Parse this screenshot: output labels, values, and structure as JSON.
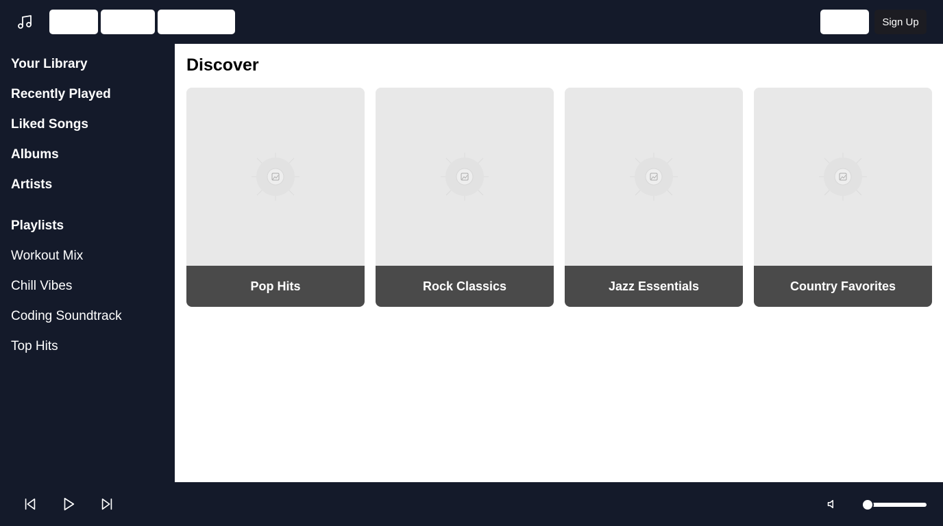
{
  "header": {
    "logo_icon": "music-note-icon",
    "nav_buttons": [
      "",
      "",
      ""
    ],
    "login_label": "",
    "signup_label": "Sign Up"
  },
  "sidebar": {
    "library_items": [
      {
        "label": "Your Library"
      },
      {
        "label": "Recently Played"
      },
      {
        "label": "Liked Songs"
      },
      {
        "label": "Albums"
      },
      {
        "label": "Artists"
      }
    ],
    "playlists_heading": "Playlists",
    "playlists": [
      {
        "label": "Workout Mix"
      },
      {
        "label": "Chill Vibes"
      },
      {
        "label": "Coding Soundtrack"
      },
      {
        "label": "Top Hits"
      }
    ]
  },
  "main": {
    "title": "Discover",
    "cards": [
      {
        "label": "Pop Hits",
        "image_icon": "image-placeholder-icon"
      },
      {
        "label": "Rock Classics",
        "image_icon": "image-placeholder-icon"
      },
      {
        "label": "Jazz Essentials",
        "image_icon": "image-placeholder-icon"
      },
      {
        "label": "Country Favorites",
        "image_icon": "image-placeholder-icon"
      }
    ]
  },
  "player": {
    "controls": [
      "skip-previous-icon",
      "play-icon",
      "skip-next-icon"
    ],
    "volume_icon": "volume-icon",
    "volume_level": 0
  },
  "colors": {
    "shell_bg": "#141a2a",
    "card_art_bg": "#e8e8e8",
    "card_label_bg": "#4a4a4a",
    "signup_bg": "#1c1c22"
  }
}
